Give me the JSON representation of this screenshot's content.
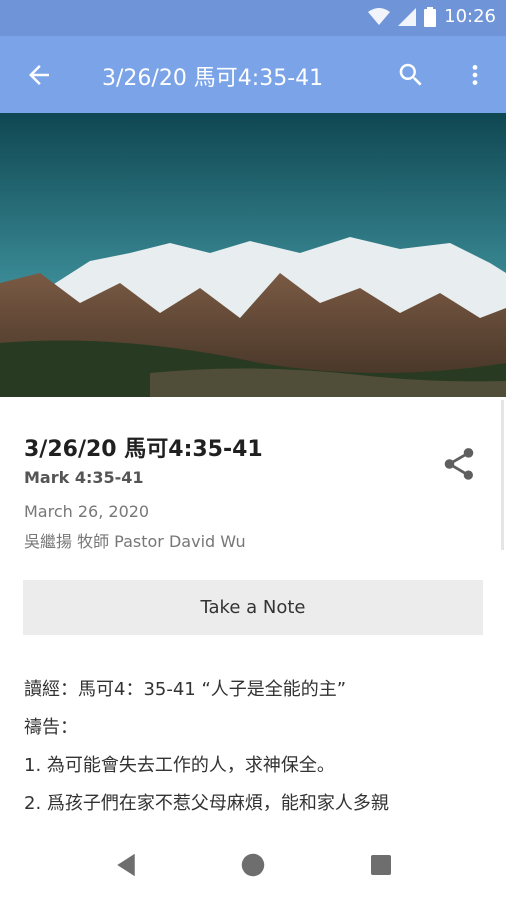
{
  "status_bar": {
    "time": "10:26",
    "icons": [
      "wifi-icon",
      "signal-icon",
      "battery-icon"
    ]
  },
  "app_bar": {
    "title": "3/26/20 馬可4:35-41",
    "icons": [
      "back-arrow-icon",
      "search-icon",
      "more-vert-icon"
    ]
  },
  "sermon": {
    "title": "3/26/20 馬可4:35-41",
    "subtitle": "Mark 4:35-41",
    "date": "March 26, 2020",
    "author": "吳繼揚 牧師 Pastor David Wu"
  },
  "note_button": {
    "label": "Take a Note"
  },
  "body_lines": [
    "讀經：馬可4：35-41 “人子是全能的主”",
    "禱告：",
    "1. 為可能會失去工作的人，求神保全。",
    "2. 爲孩子們在家不惹父母麻煩，能和家人多親"
  ],
  "colors": {
    "status_bar": "#6f95d8",
    "app_bar": "#7ba3e8",
    "button_bg": "#ececec"
  }
}
